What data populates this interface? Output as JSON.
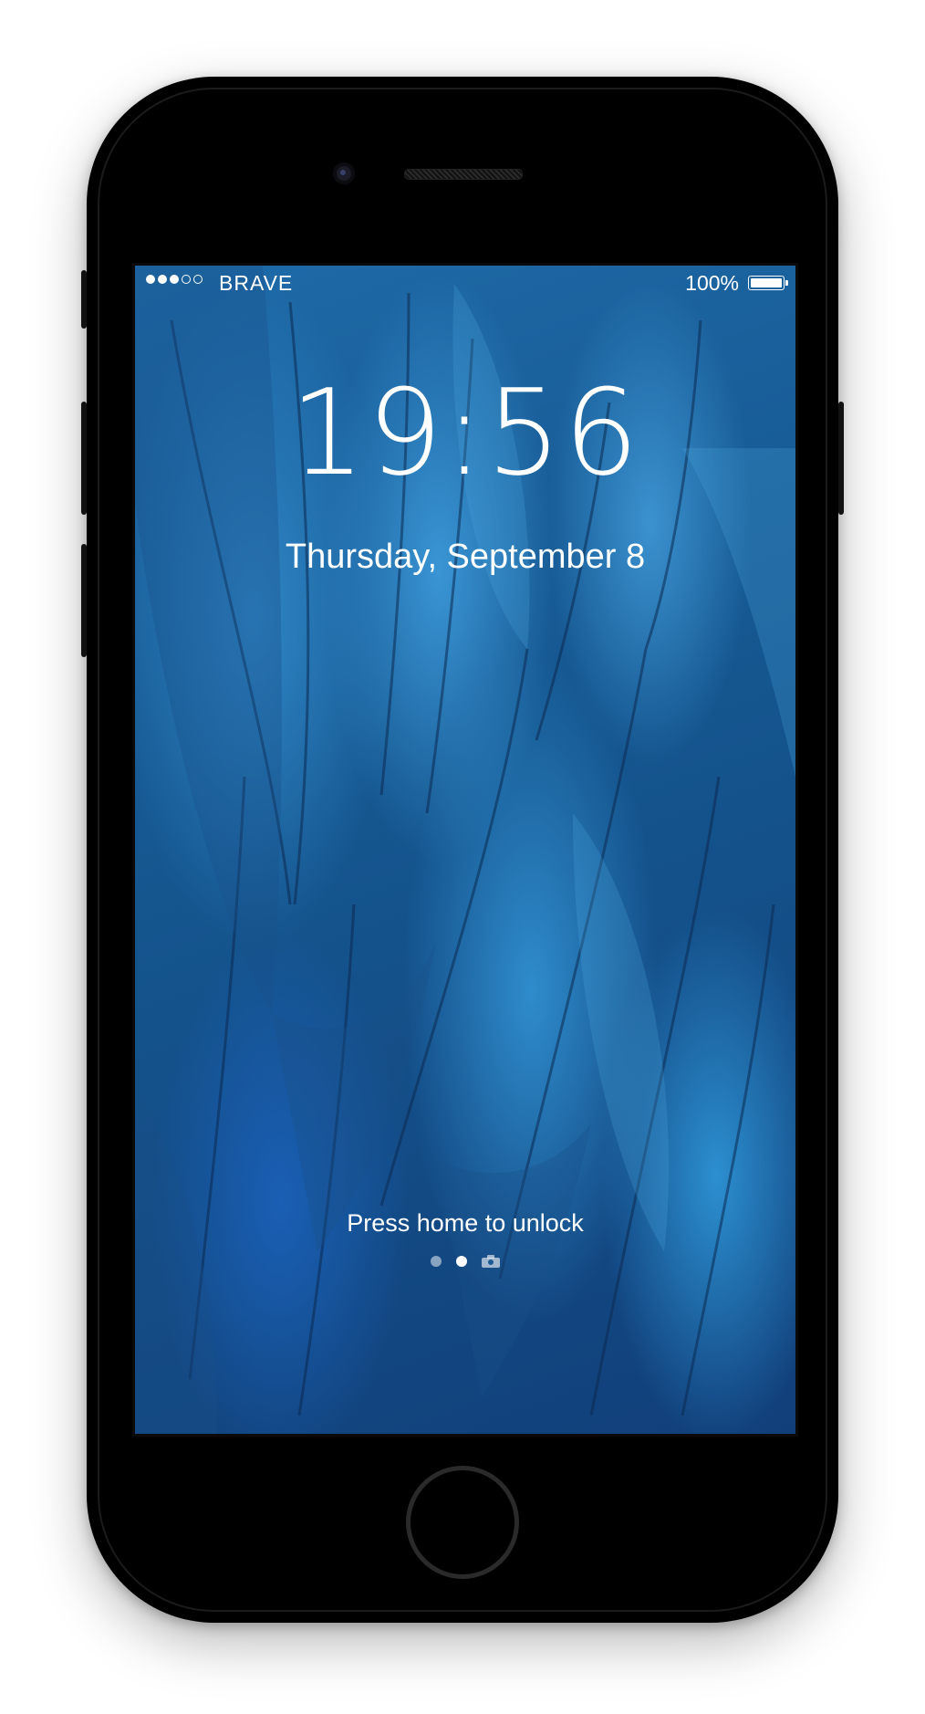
{
  "status_bar": {
    "signal_strength": 3,
    "signal_max": 5,
    "carrier": "BRAVE",
    "battery_percent": "100%",
    "battery_level": 1.0
  },
  "lock_screen": {
    "time": "19:56",
    "date": "Thursday, September 8",
    "unlock_hint": "Press home to unlock",
    "pages": [
      "page-1",
      "page-2",
      "camera"
    ],
    "active_page": 1
  },
  "colors": {
    "wallpaper_primary": "#1e6aa8",
    "text": "#ffffff",
    "device_body": "#000000"
  },
  "icons": {
    "camera_page": "camera-icon",
    "battery": "battery-icon"
  }
}
